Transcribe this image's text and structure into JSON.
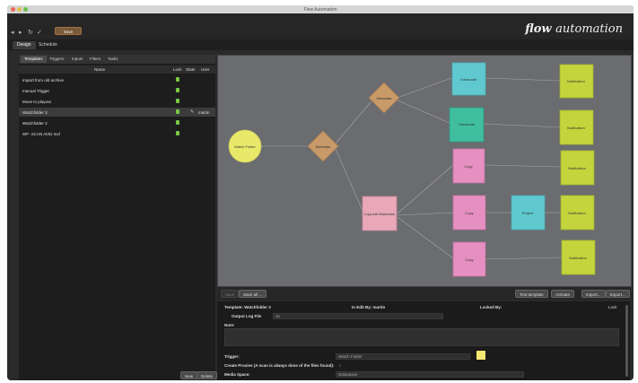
{
  "window": {
    "title": "Flow Automation"
  },
  "toolbar": {
    "save_label": "Save",
    "back_icon": "◂",
    "fwd_icon": "▸",
    "refresh_icon": "↻",
    "tool_icon": "✓"
  },
  "brand": {
    "bold": "flow",
    "rest": "automation"
  },
  "main_tabs": [
    {
      "label": "Design"
    },
    {
      "label": "Schedule"
    }
  ],
  "sub_tabs": [
    {
      "label": "Templates"
    },
    {
      "label": "Triggers"
    },
    {
      "label": "Inputs"
    },
    {
      "label": "Filters"
    },
    {
      "label": "Tasks"
    }
  ],
  "table": {
    "headers": {
      "name": "Name",
      "lock": "Lock",
      "state": "State",
      "user": "User"
    },
    "rows": [
      {
        "name": "Import from old archive",
        "user": ""
      },
      {
        "name": "manual Trigger",
        "user": ""
      },
      {
        "name": "Move to playout",
        "user": ""
      },
      {
        "name": "Watchfolder 3",
        "user": "martin"
      },
      {
        "name": "Watchfolder 2",
        "user": ""
      },
      {
        "name": "WF- SCAN AVID mxf",
        "user": ""
      }
    ]
  },
  "left_buttons": {
    "new": "New",
    "delete": "Delete"
  },
  "canvas": {
    "nodes": {
      "watch_folder": "Watch Folder",
      "metadata1": "Metadata",
      "metadata2": "Metadata",
      "transcode1": "Transcode",
      "transcode2": "Transcode",
      "copy1": "Copy",
      "copy_watermark": "Copy with Watermark",
      "copy2": "Copy",
      "copy3": "Copy",
      "project": "Project",
      "notif1": "Notification",
      "notif2": "Notification",
      "notif3": "Notification",
      "notif4": "Notification",
      "notif5": "Notification"
    }
  },
  "controls": {
    "left1": "Save",
    "left2": "Save all ...",
    "test": "Test template",
    "activate": "Activate",
    "import": "Import...",
    "export": "Export..."
  },
  "props": {
    "template_label": "Template:",
    "template_value": "Watchfolder 3",
    "in_edit_label": "In Edit By:",
    "in_edit_value": "martin",
    "locked_label": "Locked By:",
    "lock_label": "Lock",
    "output_log_label": "Output Log File",
    "output_log_value": "on",
    "note_label": "Note:",
    "trigger_label": "Trigger:",
    "trigger_value": "Watch Folder",
    "proxies_label": "Create Proxies (A scan is always done of the files found):",
    "proxies_value": "✓",
    "media_space_label": "Media Space:",
    "media_space_value": "Dataspace"
  },
  "colors": {
    "accent": "#7ac943",
    "node_yellow": "#e8e86a",
    "node_tan": "#c89a6a",
    "node_cyan": "#5fc9cf",
    "node_teal": "#3fbfa0",
    "node_pink": "#e590c0",
    "node_lime": "#c4d43c"
  }
}
